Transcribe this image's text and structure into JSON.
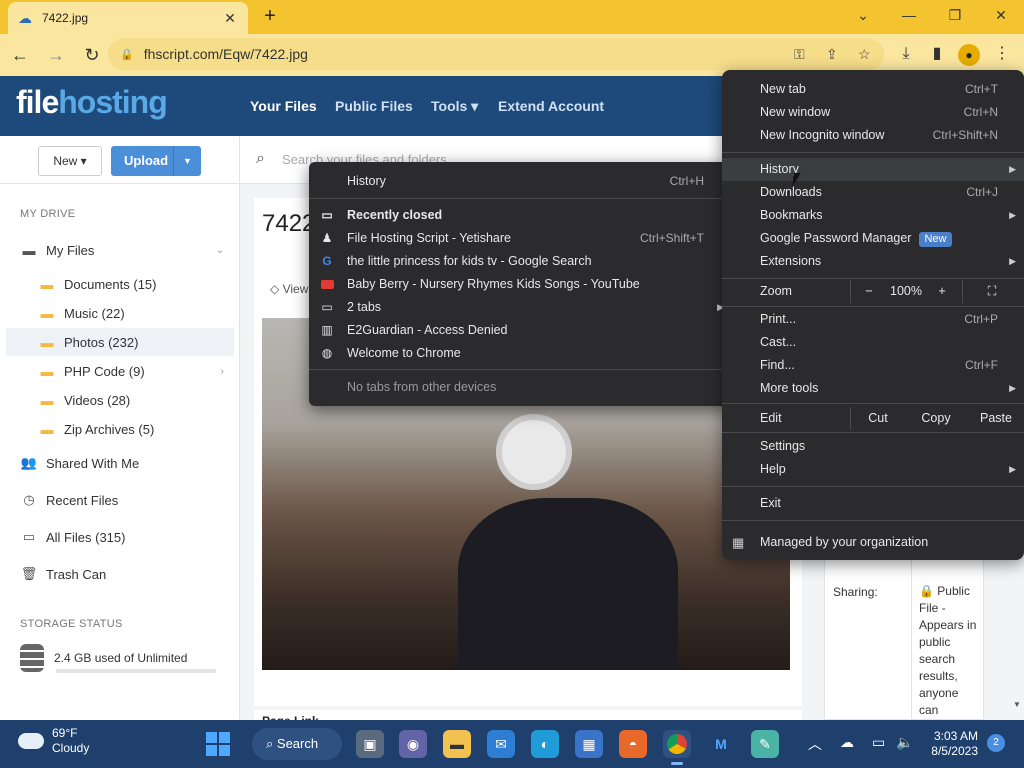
{
  "browser": {
    "tab_title": "7422.jpg",
    "url": "fhscript.com/Eqw/7422.jpg"
  },
  "site": {
    "logo_part1": "file",
    "logo_part2": "hosting",
    "nav": [
      "Your Files",
      "Public Files",
      "Tools ▾",
      "Extend Account"
    ]
  },
  "sidebar": {
    "new_label": "New ▾",
    "upload_label": "Upload",
    "my_drive_heading": "MY DRIVE",
    "my_files": "My Files",
    "folders": [
      "Documents (15)",
      "Music (22)",
      "Photos (232)",
      "PHP Code (9)",
      "Videos (28)",
      "Zip Archives (5)"
    ],
    "shared": "Shared With Me",
    "recent": "Recent Files",
    "all_files": "All Files (315)",
    "trash": "Trash Can",
    "storage_heading": "STORAGE STATUS",
    "storage_text": "2.4 GB used of Unlimited"
  },
  "main": {
    "search_placeholder": "Search your files and folders",
    "file_title": "7422",
    "view_label": "View",
    "page_link_label": "Page Link",
    "sharing_label": "Sharing:",
    "sharing_value": "Public File - Appears in public search results, anyone can"
  },
  "chrome_menu": {
    "new_tab": "New tab",
    "new_tab_sc": "Ctrl+T",
    "new_window": "New window",
    "new_window_sc": "Ctrl+N",
    "incognito": "New Incognito window",
    "incognito_sc": "Ctrl+Shift+N",
    "history": "History",
    "downloads": "Downloads",
    "downloads_sc": "Ctrl+J",
    "bookmarks": "Bookmarks",
    "password_manager": "Google Password Manager",
    "new_badge": "New",
    "extensions": "Extensions",
    "zoom": "Zoom",
    "zoom_minus": "−",
    "zoom_level": "100%",
    "zoom_plus": "+",
    "print": "Print...",
    "print_sc": "Ctrl+P",
    "cast": "Cast...",
    "find": "Find...",
    "find_sc": "Ctrl+F",
    "more_tools": "More tools",
    "edit": "Edit",
    "cut": "Cut",
    "copy": "Copy",
    "paste": "Paste",
    "settings": "Settings",
    "help": "Help",
    "exit": "Exit",
    "managed": "Managed by your organization"
  },
  "history_menu": {
    "history": "History",
    "history_sc": "Ctrl+H",
    "recently_closed": "Recently closed",
    "items": [
      {
        "label": "File Hosting Script - Yetishare",
        "shortcut": "Ctrl+Shift+T"
      },
      {
        "label": "the little princess for kids tv - Google Search",
        "shortcut": ""
      },
      {
        "label": "Baby Berry - Nursery Rhymes  Kids Songs - YouTube",
        "shortcut": ""
      },
      {
        "label": "2 tabs",
        "shortcut": ""
      },
      {
        "label": "E2Guardian - Access Denied",
        "shortcut": ""
      },
      {
        "label": "Welcome to Chrome",
        "shortcut": ""
      }
    ],
    "no_tabs": "No tabs from other devices"
  },
  "taskbar": {
    "temp": "69°F",
    "condition": "Cloudy",
    "search": "Search",
    "time": "3:03 AM",
    "date": "8/5/2023",
    "notifications": "2"
  },
  "colors": {
    "tabbar": "#f4c430",
    "site_header": "#1d4a7a",
    "accent": "#4a8fd8",
    "menu_bg": "#2b2b2e"
  }
}
